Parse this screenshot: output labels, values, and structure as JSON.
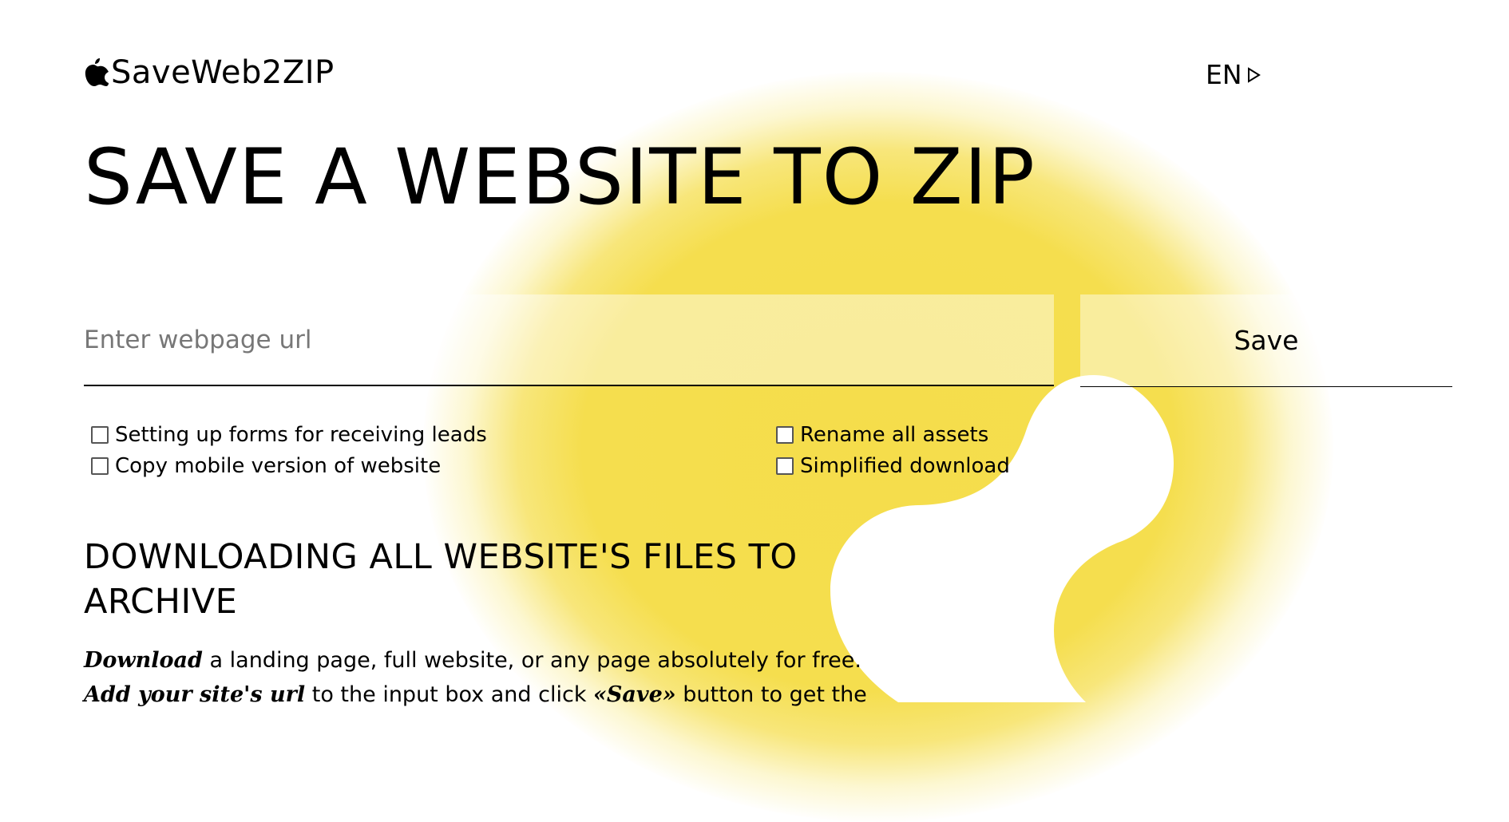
{
  "header": {
    "logo_text": "SaveWeb2ZIP",
    "language": "EN"
  },
  "hero": {
    "title": "SAVE A WEBSITE TO ZIP"
  },
  "form": {
    "url_placeholder": "Enter webpage url",
    "save_label": "Save"
  },
  "options": [
    {
      "label": "Setting up forms for receiving leads",
      "checked": false
    },
    {
      "label": "Copy mobile version of website",
      "checked": false
    },
    {
      "label": "Rename all assets",
      "checked": false
    },
    {
      "label": "Simplified download",
      "checked": false
    }
  ],
  "content": {
    "section_title": "DOWNLOADING ALL WEBSITE'S FILES TO ARCHIVE",
    "p1_emphasis": "Download",
    "p1_text": " a landing page, full website, or any page absolutely for free.",
    "p2_emphasis": "Add your site's url",
    "p2_text_a": " to the input box and click ",
    "p2_emphasis_b": "«Save»",
    "p2_text_b": " button to get the"
  },
  "colors": {
    "accent_yellow": "#f5de4e",
    "text": "#000000",
    "placeholder": "#777777"
  },
  "icons": {
    "logo": "fruit-logo-icon",
    "language_arrow": "triangle-right-outline-icon"
  }
}
